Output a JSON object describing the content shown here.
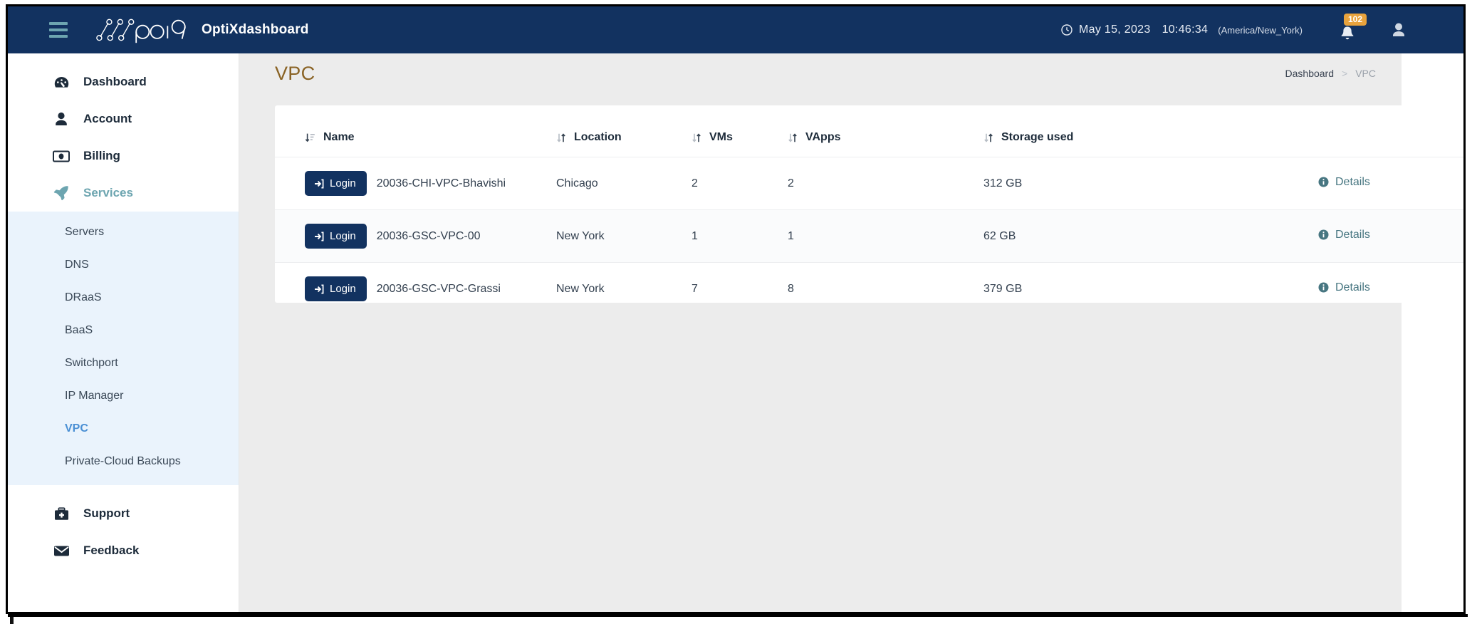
{
  "header": {
    "menu_toggle": "hamburger-menu",
    "brand": "OptiXdashboard",
    "logo_text": "opti9",
    "clock_icon": "clock-icon",
    "date": "May 15, 2023",
    "time": "10:46:34",
    "timezone": "(America/New_York)",
    "notification_count": "102",
    "bell_icon": "bell-icon",
    "avatar_icon": "user-avatar-icon",
    "bg_color": "#123260",
    "badge_color": "#e8a33d"
  },
  "sidebar": {
    "items": [
      {
        "label": "Dashboard",
        "icon": "dashboard-gauge-icon",
        "active": false
      },
      {
        "label": "Account",
        "icon": "user-icon",
        "active": false
      },
      {
        "label": "Billing",
        "icon": "money-bill-icon",
        "active": false
      },
      {
        "label": "Services",
        "icon": "rocket-icon",
        "active": true
      }
    ],
    "submenu": [
      {
        "label": "Servers",
        "active": false
      },
      {
        "label": "DNS",
        "active": false
      },
      {
        "label": "DRaaS",
        "active": false
      },
      {
        "label": "BaaS",
        "active": false
      },
      {
        "label": "Switchport",
        "active": false
      },
      {
        "label": "IP Manager",
        "active": false
      },
      {
        "label": "VPC",
        "active": true
      },
      {
        "label": "Private-Cloud Backups",
        "active": false
      }
    ],
    "footer_items": [
      {
        "label": "Support",
        "icon": "briefcase-medical-icon"
      },
      {
        "label": "Feedback",
        "icon": "envelope-icon"
      }
    ],
    "accent_color": "#6da5b0",
    "active_link_color": "#4a8fd4",
    "submenu_bg": "#eaf3fc"
  },
  "page": {
    "title": "VPC",
    "title_color": "#8a6325",
    "breadcrumb": {
      "parent": "Dashboard",
      "separator": ">",
      "current": "VPC"
    }
  },
  "table": {
    "columns": [
      {
        "label": "Name",
        "sort_icon": "sort-amount-down-icon"
      },
      {
        "label": "Location",
        "sort_icon": "sort-updown-icon"
      },
      {
        "label": "VMs",
        "sort_icon": "sort-updown-icon"
      },
      {
        "label": "VApps",
        "sort_icon": "sort-updown-icon"
      },
      {
        "label": "Storage used",
        "sort_icon": "sort-updown-icon"
      },
      {
        "label": "",
        "sort_icon": ""
      }
    ],
    "login_label": "Login",
    "login_icon": "sign-in-icon",
    "details_label": "Details",
    "details_icon": "info-circle-icon",
    "rows": [
      {
        "name": "20036-CHI-VPC-Bhavishi",
        "location": "Chicago",
        "vms": "2",
        "vapps": "2",
        "storage_used": "312 GB"
      },
      {
        "name": "20036-GSC-VPC-00",
        "location": "New York",
        "vms": "1",
        "vapps": "1",
        "storage_used": "62 GB"
      },
      {
        "name": "20036-GSC-VPC-Grassi",
        "location": "New York",
        "vms": "7",
        "vapps": "8",
        "storage_used": "379 GB"
      }
    ]
  }
}
